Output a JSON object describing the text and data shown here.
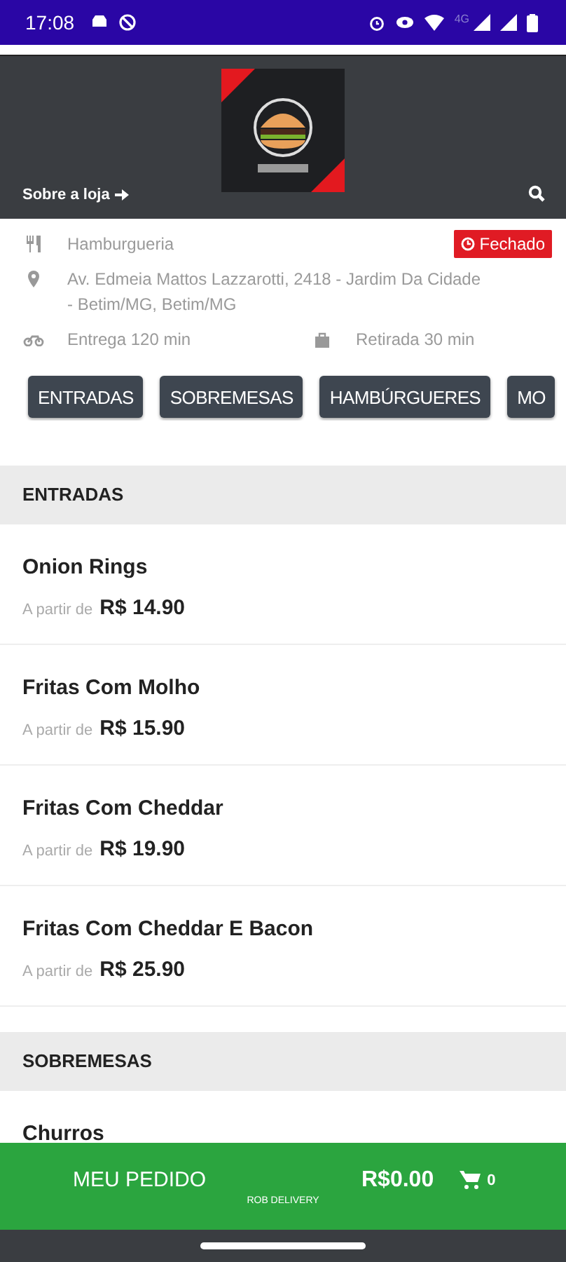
{
  "status_bar": {
    "time": "17:08",
    "network": "4G"
  },
  "header": {
    "about_link": "Sobre a loja"
  },
  "store": {
    "category": "Hamburgueria",
    "status": {
      "label": "Fechado",
      "open": false
    },
    "address": "Av. Edmeia Mattos Lazzarotti, 2418 - Jardim Da Cidade - Betim/MG, Betim/MG",
    "delivery": "Entrega 120 min",
    "pickup": "Retirada 30 min"
  },
  "category_tabs": [
    "ENTRADAS",
    "SOBREMESAS",
    "HAMBÚRGUERES",
    "MO"
  ],
  "sections": [
    {
      "title": "ENTRADAS",
      "items": [
        {
          "name": "Onion Rings",
          "price_prefix": "A partir de",
          "price": "R$ 14.90"
        },
        {
          "name": "Fritas Com Molho",
          "price_prefix": "A partir de",
          "price": "R$ 15.90"
        },
        {
          "name": "Fritas Com Cheddar",
          "price_prefix": "A partir de",
          "price": "R$ 19.90"
        },
        {
          "name": "Fritas Com Cheddar E Bacon",
          "price_prefix": "A partir de",
          "price": "R$ 25.90"
        }
      ]
    },
    {
      "title": "SOBREMESAS",
      "items": [
        {
          "name": "Churros"
        }
      ]
    }
  ],
  "cart_bar": {
    "label": "MEU PEDIDO",
    "total": "R$0.00",
    "count": "0",
    "footer": "ROB DELIVERY"
  }
}
